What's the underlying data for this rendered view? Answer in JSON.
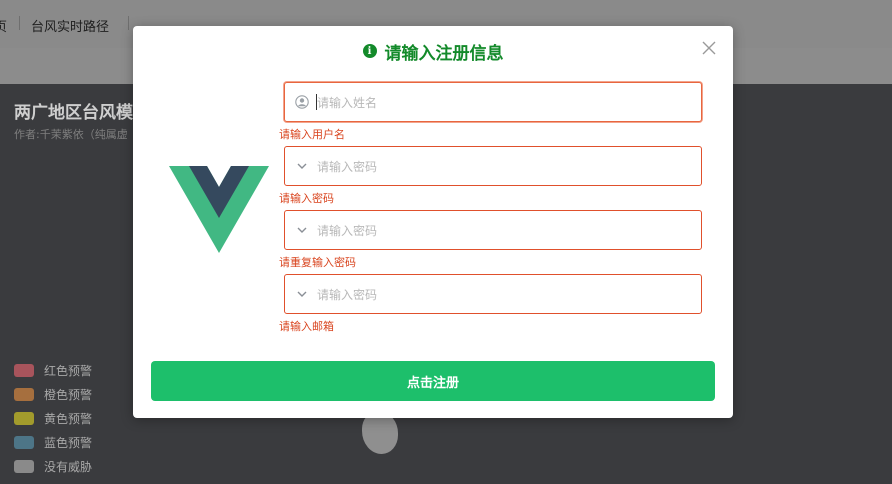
{
  "background": {
    "tabs": [
      "页",
      "台风实时路径"
    ],
    "page_title": "两广地区台风模",
    "author": "作者:千茉紫依（纯属虚",
    "legend": [
      {
        "label": "红色预警",
        "color": "#a8545c"
      },
      {
        "label": "橙色预警",
        "color": "#a66f3e"
      },
      {
        "label": "黄色预警",
        "color": "#a29b2c"
      },
      {
        "label": "蓝色预警",
        "color": "#4d7587"
      },
      {
        "label": "没有威胁",
        "color": "#8a8a8a"
      }
    ]
  },
  "dialog": {
    "info_icon": "i",
    "title": "请输入注册信息",
    "fields": [
      {
        "placeholder": "请输入姓名",
        "error": "请输入用户名",
        "icon": "user-icon"
      },
      {
        "placeholder": "请输入密码",
        "error": "请输入密码",
        "icon": "chevron-down-icon"
      },
      {
        "placeholder": "请输入密码",
        "error": "请重复输入密码",
        "icon": "chevron-down-icon"
      },
      {
        "placeholder": "请输入密码",
        "error": "请输入邮箱",
        "icon": "chevron-down-icon"
      }
    ],
    "submit_label": "点击注册"
  },
  "colors": {
    "accent": "#1dbf6b",
    "title_green": "#138a2a",
    "error": "#d9441e",
    "vue_green": "#41b883",
    "vue_dark": "#35495e"
  }
}
